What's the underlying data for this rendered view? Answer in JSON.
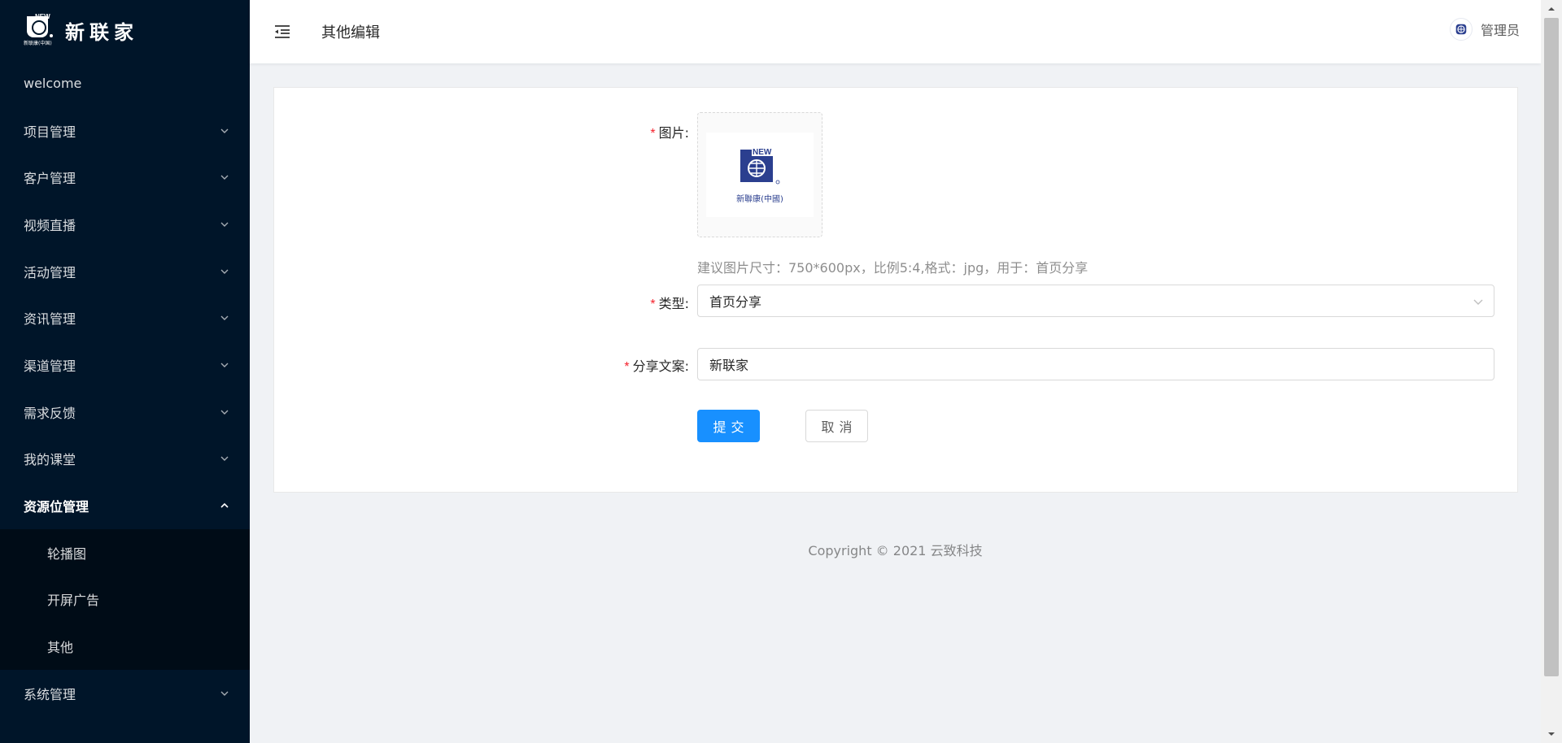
{
  "brand": {
    "logo_new": "NEW",
    "logo_sub": "新联康(中国)",
    "name": "新联家"
  },
  "sidebar": {
    "items": [
      {
        "label": "welcome"
      },
      {
        "label": "项目管理"
      },
      {
        "label": "客户管理"
      },
      {
        "label": "视频直播"
      },
      {
        "label": "活动管理"
      },
      {
        "label": "资讯管理"
      },
      {
        "label": "渠道管理"
      },
      {
        "label": "需求反馈"
      },
      {
        "label": "我的课堂"
      },
      {
        "label": "资源位管理",
        "open": true
      },
      {
        "label": "系统管理"
      }
    ],
    "submenu": [
      {
        "label": "轮播图"
      },
      {
        "label": "开屏广告"
      },
      {
        "label": "其他"
      }
    ]
  },
  "header": {
    "title": "其他编辑",
    "user": "管理员"
  },
  "form": {
    "image_label": "图片:",
    "image_logo_new": "NEW",
    "image_logo_text": "新聯康(中國)",
    "help": "建议图片尺寸：750*600px，比例5:4,格式：jpg，用于：首页分享",
    "type_label": "类型:",
    "type_value": "首页分享",
    "copy_label": "分享文案:",
    "copy_value": "新联家",
    "submit": "提交",
    "cancel": "取消",
    "required_mark": "*"
  },
  "footer": {
    "copyright": "Copyright © 2021 云致科技"
  },
  "colors": {
    "sider_bg": "#001529",
    "submenu_bg": "#000c17",
    "primary": "#1890ff",
    "required": "#f5222d",
    "logo_blue": "#2b3f8f"
  }
}
